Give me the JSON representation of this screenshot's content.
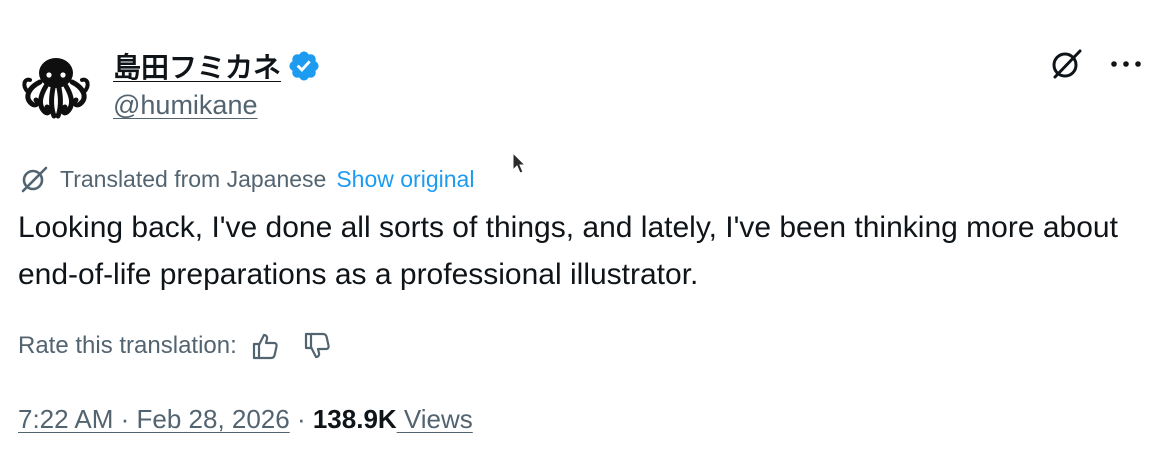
{
  "author": {
    "display_name": "島田フミカネ",
    "handle": "@humikane",
    "verified": true,
    "avatar_icon": "octopus-avatar-icon",
    "verified_color": "#1d9bf0"
  },
  "top_actions": {
    "grok_icon": "grok-icon",
    "more_icon": "more-dots-icon",
    "more_label": "···"
  },
  "translation": {
    "icon": "grok-translate-icon",
    "label": "Translated from Japanese",
    "show_original": "Show original",
    "link_color": "#1d9bf0"
  },
  "tweet": {
    "text": "Looking back, I've done all sorts of things, and lately, I've been thinking more about end-of-life preparations as a professional illustrator."
  },
  "rate": {
    "label": "Rate this translation:",
    "thumbs_up_icon": "thumbs-up-icon",
    "thumbs_down_icon": "thumbs-down-icon"
  },
  "meta": {
    "timestamp": "7:22 AM · Feb 28, 2026",
    "separator": " · ",
    "views_count": "138.9K",
    "views_label": " Views"
  }
}
